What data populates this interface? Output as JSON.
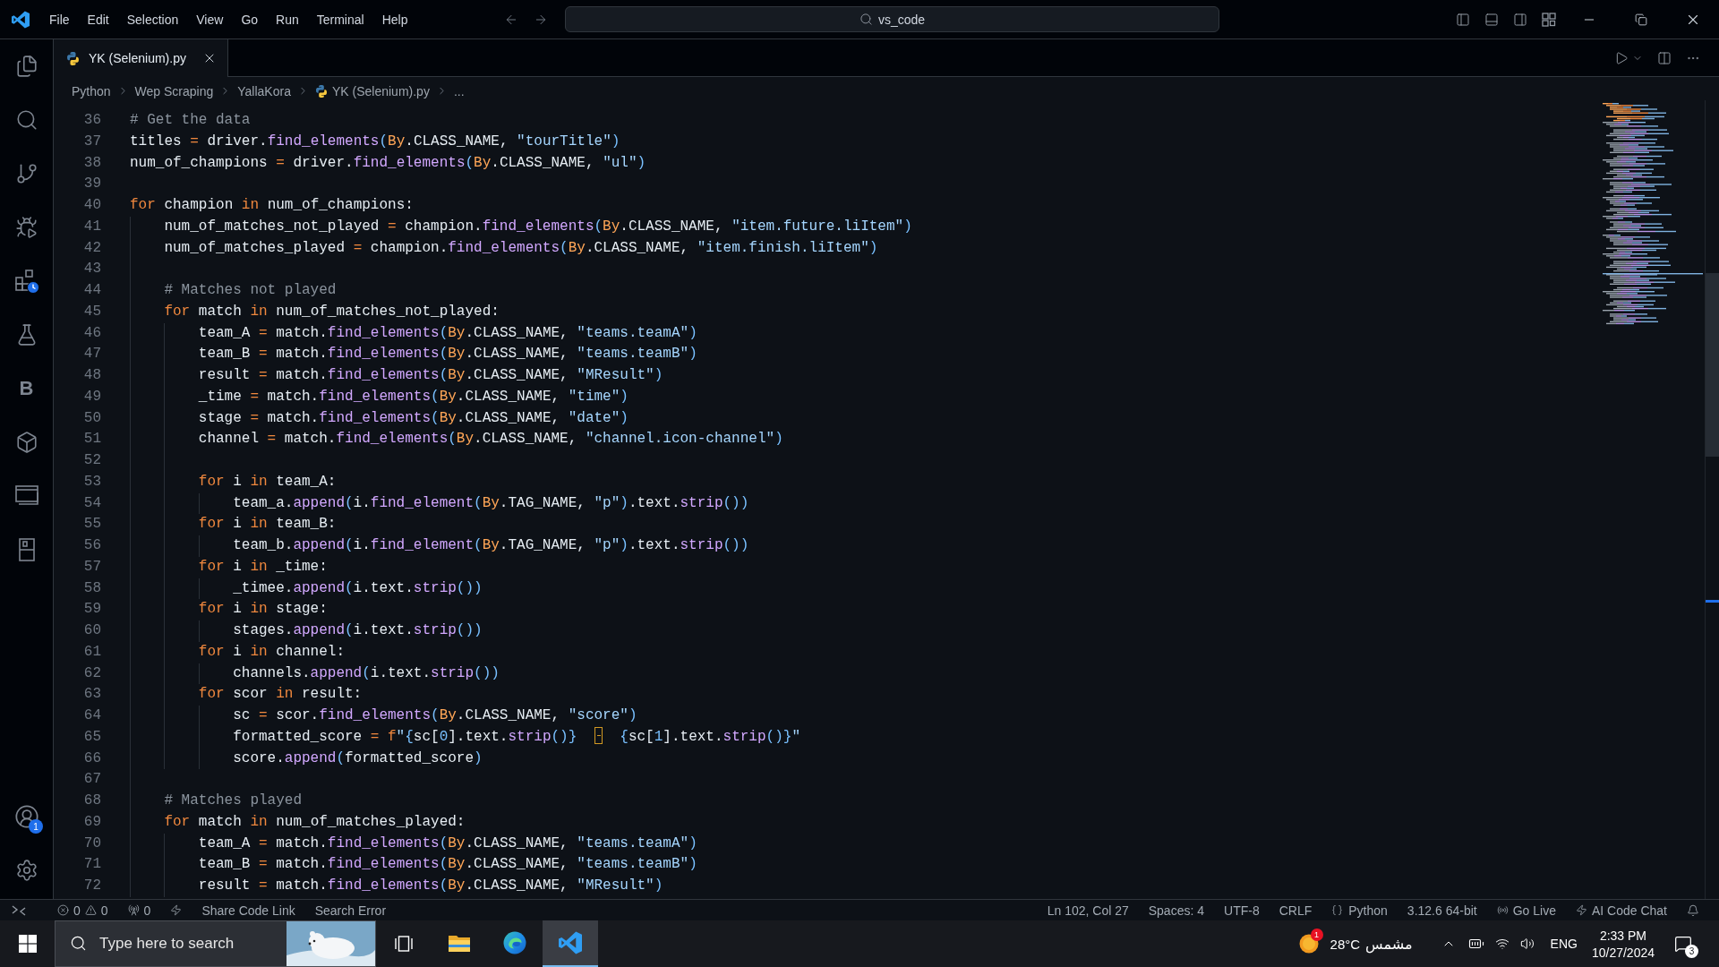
{
  "title_bar": {
    "menu": [
      "File",
      "Edit",
      "Selection",
      "View",
      "Go",
      "Run",
      "Terminal",
      "Help"
    ],
    "workspace_label": "vs_code"
  },
  "activity_bar": {
    "letter_item": "B",
    "accounts_badge": "1"
  },
  "tabs": [
    {
      "label": "YK (Selenium).py",
      "selected": true
    }
  ],
  "breadcrumb": [
    {
      "kind": "folder",
      "label": "Python"
    },
    {
      "kind": "folder",
      "label": "Wep Scraping"
    },
    {
      "kind": "folder",
      "label": "YallaKora"
    },
    {
      "kind": "file",
      "label": "YK (Selenium).py"
    },
    {
      "kind": "symbol",
      "label": "..."
    }
  ],
  "editor": {
    "lines": [
      {
        "number": "36",
        "tokens": [
          {
            "kind": "comment",
            "text": "# Get the data"
          }
        ]
      },
      {
        "number": "37",
        "tokens": [
          {
            "kind": "plain",
            "text": "titles "
          },
          {
            "kind": "operator",
            "text": "="
          },
          {
            "kind": "plain",
            "text": " driver."
          },
          {
            "kind": "function",
            "text": "find_elements"
          },
          {
            "kind": "bracket",
            "text": "("
          },
          {
            "kind": "class",
            "text": "By"
          },
          {
            "kind": "plain",
            "text": ".CLASS_NAME, "
          },
          {
            "kind": "string",
            "text": "\"tourTitle\""
          },
          {
            "kind": "bracket",
            "text": ")"
          }
        ]
      },
      {
        "number": "38",
        "tokens": [
          {
            "kind": "plain",
            "text": "num_of_champions "
          },
          {
            "kind": "operator",
            "text": "="
          },
          {
            "kind": "plain",
            "text": " driver."
          },
          {
            "kind": "function",
            "text": "find_elements"
          },
          {
            "kind": "bracket",
            "text": "("
          },
          {
            "kind": "class",
            "text": "By"
          },
          {
            "kind": "plain",
            "text": ".CLASS_NAME, "
          },
          {
            "kind": "string",
            "text": "\"ul\""
          },
          {
            "kind": "bracket",
            "text": ")"
          }
        ]
      },
      {
        "number": "39"
      },
      {
        "number": "40",
        "tokens": [
          {
            "kind": "keyword",
            "text": "for"
          },
          {
            "kind": "plain",
            "text": " champion "
          },
          {
            "kind": "keyword",
            "text": "in"
          },
          {
            "kind": "plain",
            "text": " num_of_champions:"
          }
        ],
        "children": [
          {
            "number": "41",
            "tokens": [
              {
                "kind": "plain",
                "text": "num_of_matches_not_played "
              },
              {
                "kind": "operator",
                "text": "="
              },
              {
                "kind": "plain",
                "text": " champion."
              },
              {
                "kind": "function",
                "text": "find_elements"
              },
              {
                "kind": "bracket",
                "text": "("
              },
              {
                "kind": "class",
                "text": "By"
              },
              {
                "kind": "plain",
                "text": ".CLASS_NAME, "
              },
              {
                "kind": "string",
                "text": "\"item.future.liItem\""
              },
              {
                "kind": "bracket",
                "text": ")"
              }
            ]
          },
          {
            "number": "42",
            "tokens": [
              {
                "kind": "plain",
                "text": "num_of_matches_played "
              },
              {
                "kind": "operator",
                "text": "="
              },
              {
                "kind": "plain",
                "text": " champion."
              },
              {
                "kind": "function",
                "text": "find_elements"
              },
              {
                "kind": "bracket",
                "text": "("
              },
              {
                "kind": "class",
                "text": "By"
              },
              {
                "kind": "plain",
                "text": ".CLASS_NAME, "
              },
              {
                "kind": "string",
                "text": "\"item.finish.liItem\""
              },
              {
                "kind": "bracket",
                "text": ")"
              }
            ]
          },
          {
            "number": "43"
          },
          {
            "number": "44",
            "tokens": [
              {
                "kind": "comment",
                "text": "# Matches not played"
              }
            ]
          },
          {
            "number": "45",
            "tokens": [
              {
                "kind": "keyword",
                "text": "for"
              },
              {
                "kind": "plain",
                "text": " match "
              },
              {
                "kind": "keyword",
                "text": "in"
              },
              {
                "kind": "plain",
                "text": " num_of_matches_not_played:"
              }
            ],
            "children": [
              {
                "number": "46",
                "tokens": [
                  {
                    "kind": "plain",
                    "text": "team_A "
                  },
                  {
                    "kind": "operator",
                    "text": "="
                  },
                  {
                    "kind": "plain",
                    "text": " match."
                  },
                  {
                    "kind": "function",
                    "text": "find_elements"
                  },
                  {
                    "kind": "bracket",
                    "text": "("
                  },
                  {
                    "kind": "class",
                    "text": "By"
                  },
                  {
                    "kind": "plain",
                    "text": ".CLASS_NAME, "
                  },
                  {
                    "kind": "string",
                    "text": "\"teams.teamA\""
                  },
                  {
                    "kind": "bracket",
                    "text": ")"
                  }
                ]
              },
              {
                "number": "47",
                "tokens": [
                  {
                    "kind": "plain",
                    "text": "team_B "
                  },
                  {
                    "kind": "operator",
                    "text": "="
                  },
                  {
                    "kind": "plain",
                    "text": " match."
                  },
                  {
                    "kind": "function",
                    "text": "find_elements"
                  },
                  {
                    "kind": "bracket",
                    "text": "("
                  },
                  {
                    "kind": "class",
                    "text": "By"
                  },
                  {
                    "kind": "plain",
                    "text": ".CLASS_NAME, "
                  },
                  {
                    "kind": "string",
                    "text": "\"teams.teamB\""
                  },
                  {
                    "kind": "bracket",
                    "text": ")"
                  }
                ]
              },
              {
                "number": "48",
                "tokens": [
                  {
                    "kind": "plain",
                    "text": "result "
                  },
                  {
                    "kind": "operator",
                    "text": "="
                  },
                  {
                    "kind": "plain",
                    "text": " match."
                  },
                  {
                    "kind": "function",
                    "text": "find_elements"
                  },
                  {
                    "kind": "bracket",
                    "text": "("
                  },
                  {
                    "kind": "class",
                    "text": "By"
                  },
                  {
                    "kind": "plain",
                    "text": ".CLASS_NAME, "
                  },
                  {
                    "kind": "string",
                    "text": "\"MResult\""
                  },
                  {
                    "kind": "bracket",
                    "text": ")"
                  }
                ]
              },
              {
                "number": "49",
                "tokens": [
                  {
                    "kind": "plain",
                    "text": "_time "
                  },
                  {
                    "kind": "operator",
                    "text": "="
                  },
                  {
                    "kind": "plain",
                    "text": " match."
                  },
                  {
                    "kind": "function",
                    "text": "find_elements"
                  },
                  {
                    "kind": "bracket",
                    "text": "("
                  },
                  {
                    "kind": "class",
                    "text": "By"
                  },
                  {
                    "kind": "plain",
                    "text": ".CLASS_NAME, "
                  },
                  {
                    "kind": "string",
                    "text": "\"time\""
                  },
                  {
                    "kind": "bracket",
                    "text": ")"
                  }
                ]
              },
              {
                "number": "50",
                "tokens": [
                  {
                    "kind": "plain",
                    "text": "stage "
                  },
                  {
                    "kind": "operator",
                    "text": "="
                  },
                  {
                    "kind": "plain",
                    "text": " match."
                  },
                  {
                    "kind": "function",
                    "text": "find_elements"
                  },
                  {
                    "kind": "bracket",
                    "text": "("
                  },
                  {
                    "kind": "class",
                    "text": "By"
                  },
                  {
                    "kind": "plain",
                    "text": ".CLASS_NAME, "
                  },
                  {
                    "kind": "string",
                    "text": "\"date\""
                  },
                  {
                    "kind": "bracket",
                    "text": ")"
                  }
                ]
              },
              {
                "number": "51",
                "tokens": [
                  {
                    "kind": "plain",
                    "text": "channel "
                  },
                  {
                    "kind": "operator",
                    "text": "="
                  },
                  {
                    "kind": "plain",
                    "text": " match."
                  },
                  {
                    "kind": "function",
                    "text": "find_elements"
                  },
                  {
                    "kind": "bracket",
                    "text": "("
                  },
                  {
                    "kind": "class",
                    "text": "By"
                  },
                  {
                    "kind": "plain",
                    "text": ".CLASS_NAME, "
                  },
                  {
                    "kind": "string",
                    "text": "\"channel.icon-channel\""
                  },
                  {
                    "kind": "bracket",
                    "text": ")"
                  }
                ]
              },
              {
                "number": "52"
              },
              {
                "number": "53",
                "tokens": [
                  {
                    "kind": "keyword",
                    "text": "for"
                  },
                  {
                    "kind": "plain",
                    "text": " i "
                  },
                  {
                    "kind": "keyword",
                    "text": "in"
                  },
                  {
                    "kind": "plain",
                    "text": " team_A:"
                  }
                ],
                "children": [
                  {
                    "number": "54",
                    "tokens": [
                      {
                        "kind": "plain",
                        "text": "team_a."
                      },
                      {
                        "kind": "function",
                        "text": "append"
                      },
                      {
                        "kind": "bracket",
                        "text": "("
                      },
                      {
                        "kind": "plain",
                        "text": "i."
                      },
                      {
                        "kind": "function",
                        "text": "find_element"
                      },
                      {
                        "kind": "bracket",
                        "text": "("
                      },
                      {
                        "kind": "class",
                        "text": "By"
                      },
                      {
                        "kind": "plain",
                        "text": ".TAG_NAME, "
                      },
                      {
                        "kind": "string",
                        "text": "\"p\""
                      },
                      {
                        "kind": "bracket",
                        "text": ")"
                      },
                      {
                        "kind": "plain",
                        "text": ".text."
                      },
                      {
                        "kind": "function",
                        "text": "strip"
                      },
                      {
                        "kind": "bracket",
                        "text": "())"
                      }
                    ]
                  }
                ]
              },
              {
                "number": "55",
                "tokens": [
                  {
                    "kind": "keyword",
                    "text": "for"
                  },
                  {
                    "kind": "plain",
                    "text": " i "
                  },
                  {
                    "kind": "keyword",
                    "text": "in"
                  },
                  {
                    "kind": "plain",
                    "text": " team_B:"
                  }
                ],
                "children": [
                  {
                    "number": "56",
                    "tokens": [
                      {
                        "kind": "plain",
                        "text": "team_b."
                      },
                      {
                        "kind": "function",
                        "text": "append"
                      },
                      {
                        "kind": "bracket",
                        "text": "("
                      },
                      {
                        "kind": "plain",
                        "text": "i."
                      },
                      {
                        "kind": "function",
                        "text": "find_element"
                      },
                      {
                        "kind": "bracket",
                        "text": "("
                      },
                      {
                        "kind": "class",
                        "text": "By"
                      },
                      {
                        "kind": "plain",
                        "text": ".TAG_NAME, "
                      },
                      {
                        "kind": "string",
                        "text": "\"p\""
                      },
                      {
                        "kind": "bracket",
                        "text": ")"
                      },
                      {
                        "kind": "plain",
                        "text": ".text."
                      },
                      {
                        "kind": "function",
                        "text": "strip"
                      },
                      {
                        "kind": "bracket",
                        "text": "())"
                      }
                    ]
                  }
                ]
              },
              {
                "number": "57",
                "tokens": [
                  {
                    "kind": "keyword",
                    "text": "for"
                  },
                  {
                    "kind": "plain",
                    "text": " i "
                  },
                  {
                    "kind": "keyword",
                    "text": "in"
                  },
                  {
                    "kind": "plain",
                    "text": " _time:"
                  }
                ],
                "children": [
                  {
                    "number": "58",
                    "tokens": [
                      {
                        "kind": "plain",
                        "text": "_timee."
                      },
                      {
                        "kind": "function",
                        "text": "append"
                      },
                      {
                        "kind": "bracket",
                        "text": "("
                      },
                      {
                        "kind": "plain",
                        "text": "i.text."
                      },
                      {
                        "kind": "function",
                        "text": "strip"
                      },
                      {
                        "kind": "bracket",
                        "text": "())"
                      }
                    ]
                  }
                ]
              },
              {
                "number": "59",
                "tokens": [
                  {
                    "kind": "keyword",
                    "text": "for"
                  },
                  {
                    "kind": "plain",
                    "text": " i "
                  },
                  {
                    "kind": "keyword",
                    "text": "in"
                  },
                  {
                    "kind": "plain",
                    "text": " stage:"
                  }
                ],
                "children": [
                  {
                    "number": "60",
                    "tokens": [
                      {
                        "kind": "plain",
                        "text": "stages."
                      },
                      {
                        "kind": "function",
                        "text": "append"
                      },
                      {
                        "kind": "bracket",
                        "text": "("
                      },
                      {
                        "kind": "plain",
                        "text": "i.text."
                      },
                      {
                        "kind": "function",
                        "text": "strip"
                      },
                      {
                        "kind": "bracket",
                        "text": "())"
                      }
                    ]
                  }
                ]
              },
              {
                "number": "61",
                "tokens": [
                  {
                    "kind": "keyword",
                    "text": "for"
                  },
                  {
                    "kind": "plain",
                    "text": " i "
                  },
                  {
                    "kind": "keyword",
                    "text": "in"
                  },
                  {
                    "kind": "plain",
                    "text": " channel:"
                  }
                ],
                "children": [
                  {
                    "number": "62",
                    "tokens": [
                      {
                        "kind": "plain",
                        "text": "channels."
                      },
                      {
                        "kind": "function",
                        "text": "append"
                      },
                      {
                        "kind": "bracket",
                        "text": "("
                      },
                      {
                        "kind": "plain",
                        "text": "i.text."
                      },
                      {
                        "kind": "function",
                        "text": "strip"
                      },
                      {
                        "kind": "bracket",
                        "text": "())"
                      }
                    ]
                  }
                ]
              },
              {
                "number": "63",
                "tokens": [
                  {
                    "kind": "keyword",
                    "text": "for"
                  },
                  {
                    "kind": "plain",
                    "text": " scor "
                  },
                  {
                    "kind": "keyword",
                    "text": "in"
                  },
                  {
                    "kind": "plain",
                    "text": " result:"
                  }
                ],
                "children": [
                  {
                    "number": "64",
                    "tokens": [
                      {
                        "kind": "plain",
                        "text": "sc "
                      },
                      {
                        "kind": "operator",
                        "text": "="
                      },
                      {
                        "kind": "plain",
                        "text": " scor."
                      },
                      {
                        "kind": "function",
                        "text": "find_elements"
                      },
                      {
                        "kind": "bracket",
                        "text": "("
                      },
                      {
                        "kind": "class",
                        "text": "By"
                      },
                      {
                        "kind": "plain",
                        "text": ".CLASS_NAME, "
                      },
                      {
                        "kind": "string",
                        "text": "\"score\""
                      },
                      {
                        "kind": "bracket",
                        "text": ")"
                      }
                    ]
                  },
                  {
                    "number": "65",
                    "tokens": [
                      {
                        "kind": "plain",
                        "text": "formatted_score "
                      },
                      {
                        "kind": "operator",
                        "text": "="
                      },
                      {
                        "kind": "keyword",
                        "text": " f"
                      },
                      {
                        "kind": "string",
                        "text": "\""
                      },
                      {
                        "kind": "placeholder",
                        "text": "{"
                      },
                      {
                        "kind": "plain",
                        "text": "sc["
                      },
                      {
                        "kind": "number",
                        "text": "0"
                      },
                      {
                        "kind": "plain",
                        "text": "].text."
                      },
                      {
                        "kind": "function",
                        "text": "strip"
                      },
                      {
                        "kind": "bracket",
                        "text": "()"
                      },
                      {
                        "kind": "placeholder",
                        "text": "}  "
                      },
                      {
                        "kind": "marker"
                      },
                      {
                        "kind": "placeholder",
                        "text": "  {"
                      },
                      {
                        "kind": "plain",
                        "text": "sc["
                      },
                      {
                        "kind": "number",
                        "text": "1"
                      },
                      {
                        "kind": "plain",
                        "text": "].text."
                      },
                      {
                        "kind": "function",
                        "text": "strip"
                      },
                      {
                        "kind": "bracket",
                        "text": "()"
                      },
                      {
                        "kind": "placeholder",
                        "text": "}"
                      },
                      {
                        "kind": "string",
                        "text": "\""
                      }
                    ]
                  },
                  {
                    "number": "66",
                    "tokens": [
                      {
                        "kind": "plain",
                        "text": "score."
                      },
                      {
                        "kind": "function",
                        "text": "append"
                      },
                      {
                        "kind": "bracket",
                        "text": "("
                      },
                      {
                        "kind": "plain",
                        "text": "formatted_score"
                      },
                      {
                        "kind": "bracket",
                        "text": ")"
                      }
                    ]
                  }
                ]
              }
            ]
          },
          {
            "number": "67"
          },
          {
            "number": "68",
            "tokens": [
              {
                "kind": "comment",
                "text": "# Matches played"
              }
            ]
          },
          {
            "number": "69",
            "tokens": [
              {
                "kind": "keyword",
                "text": "for"
              },
              {
                "kind": "plain",
                "text": " match "
              },
              {
                "kind": "keyword",
                "text": "in"
              },
              {
                "kind": "plain",
                "text": " num_of_matches_played:"
              }
            ],
            "children": [
              {
                "number": "70",
                "tokens": [
                  {
                    "kind": "plain",
                    "text": "team_A "
                  },
                  {
                    "kind": "operator",
                    "text": "="
                  },
                  {
                    "kind": "plain",
                    "text": " match."
                  },
                  {
                    "kind": "function",
                    "text": "find_elements"
                  },
                  {
                    "kind": "bracket",
                    "text": "("
                  },
                  {
                    "kind": "class",
                    "text": "By"
                  },
                  {
                    "kind": "plain",
                    "text": ".CLASS_NAME, "
                  },
                  {
                    "kind": "string",
                    "text": "\"teams.teamA\""
                  },
                  {
                    "kind": "bracket",
                    "text": ")"
                  }
                ]
              },
              {
                "number": "71",
                "tokens": [
                  {
                    "kind": "plain",
                    "text": "team_B "
                  },
                  {
                    "kind": "operator",
                    "text": "="
                  },
                  {
                    "kind": "plain",
                    "text": " match."
                  },
                  {
                    "kind": "function",
                    "text": "find_elements"
                  },
                  {
                    "kind": "bracket",
                    "text": "("
                  },
                  {
                    "kind": "class",
                    "text": "By"
                  },
                  {
                    "kind": "plain",
                    "text": ".CLASS_NAME, "
                  },
                  {
                    "kind": "string",
                    "text": "\"teams.teamB\""
                  },
                  {
                    "kind": "bracket",
                    "text": ")"
                  }
                ]
              },
              {
                "number": "72",
                "tokens": [
                  {
                    "kind": "plain",
                    "text": "result "
                  },
                  {
                    "kind": "operator",
                    "text": "="
                  },
                  {
                    "kind": "plain",
                    "text": " match."
                  },
                  {
                    "kind": "function",
                    "text": "find_elements"
                  },
                  {
                    "kind": "bracket",
                    "text": "("
                  },
                  {
                    "kind": "class",
                    "text": "By"
                  },
                  {
                    "kind": "plain",
                    "text": ".CLASS_NAME, "
                  },
                  {
                    "kind": "string",
                    "text": "\"MResult\""
                  },
                  {
                    "kind": "bracket",
                    "text": ")"
                  }
                ]
              }
            ]
          }
        ]
      }
    ]
  },
  "status_bar": {
    "errors": "0",
    "warnings": "0",
    "ports": "0",
    "share": "Share Code Link",
    "search_error": "Search Error",
    "cursor": "Ln 102, Col 27",
    "indentation": "Spaces: 4",
    "encoding": "UTF-8",
    "line_ending": "CRLF",
    "language": "Python",
    "interpreter": "3.12.6 64-bit",
    "live_server": "Go Live",
    "ai_chat": "AI Code Chat"
  },
  "taskbar": {
    "search": {
      "placeholder": "Type here to search"
    },
    "apps": [
      {
        "kind": "folder",
        "selected": false
      },
      {
        "kind": "browser",
        "selected": false
      },
      {
        "kind": "editor",
        "selected": true
      }
    ],
    "weather": {
      "badge": "1",
      "temperature": "28°C",
      "condition": "مشمس"
    },
    "language": "ENG",
    "time": "2:33 PM",
    "date": "10/27/2024",
    "notification_count": "3"
  }
}
